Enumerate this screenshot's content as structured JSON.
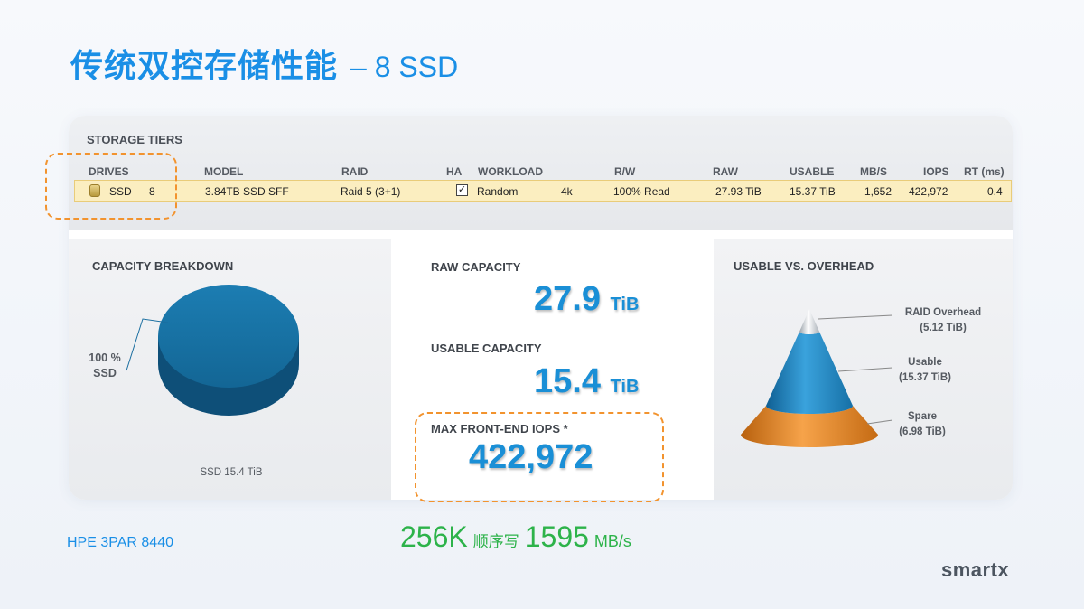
{
  "title": {
    "cn": "传统双控存储性能",
    "en": "– 8 SSD"
  },
  "storage_tiers": {
    "heading": "STORAGE TIERS",
    "columns": {
      "drives": "DRIVES",
      "model": "MODEL",
      "raid": "RAID",
      "ha": "HA",
      "workload": "WORKLOAD",
      "rw": "R/W",
      "raw": "RAW",
      "usable": "USABLE",
      "mbs": "MB/S",
      "iops": "IOPS",
      "rt": "RT (ms)"
    },
    "row": {
      "drive_type": "SSD",
      "drive_count": "8",
      "model": "3.84TB SSD SFF",
      "raid": "Raid 5 (3+1)",
      "ha_checked": "✓",
      "workload": "Random",
      "block": "4k",
      "rw": "100% Read",
      "raw": "27.93 TiB",
      "usable": "15.37 TiB",
      "mbs": "1,652",
      "iops": "422,972",
      "rt": "0.4"
    }
  },
  "capacity_breakdown": {
    "title": "CAPACITY BREAKDOWN",
    "pie_label_pct": "100 %",
    "pie_label_type": "SSD",
    "legend": "SSD  15.4 TiB"
  },
  "capacity": {
    "raw_title": "RAW CAPACITY",
    "raw_value": "27.9",
    "raw_unit": "TiB",
    "usable_title": "USABLE CAPACITY",
    "usable_value": "15.4",
    "usable_unit": "TiB",
    "iops_title": "MAX FRONT-END IOPS *",
    "iops_value": "422,972"
  },
  "usable_vs_overhead": {
    "title": "USABLE VS. OVERHEAD",
    "labels": [
      {
        "name": "RAID Overhead",
        "value": "(5.12 TiB)"
      },
      {
        "name": "Usable",
        "value": "(15.37 TiB)"
      },
      {
        "name": "Spare",
        "value": "(6.98 TiB)"
      }
    ]
  },
  "footer": {
    "product": "HPE 3PAR 8440",
    "seq_iops": "256K",
    "seq_label": "顺序写",
    "seq_bw": "1595",
    "seq_unit": "MB/s",
    "logo": "smartx"
  },
  "colors": {
    "accent_blue": "#1a8fe6",
    "highlight_orange": "#f2932e",
    "seq_green": "#2db34a",
    "pie_blue": "#176e9e"
  }
}
